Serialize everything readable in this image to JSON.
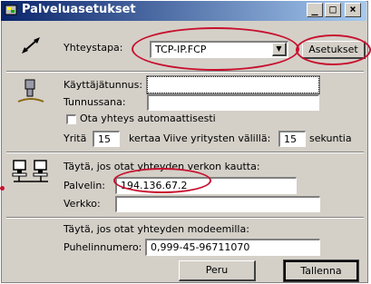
{
  "window": {
    "title": "Palveluasetukset"
  },
  "titlebar_buttons": {
    "minimize": "_",
    "maximize": "□",
    "close": "×"
  },
  "connection": {
    "method_label": "Yhteystapa:",
    "method_value": "TCP-IP.FCP",
    "settings_button": "Asetukset"
  },
  "login": {
    "username_label": "Käyttäjätunnus:",
    "username_value": "",
    "password_label": "Tunnussana:",
    "password_value": "",
    "auto_connect_label": "Ota yhteys automaattisesti",
    "auto_connect_checked": false,
    "retry_prefix": "Yritä",
    "retry_count": "15",
    "retry_mid": "kertaa",
    "delay_label": "Viive yritysten välillä:",
    "delay_value": "15",
    "delay_unit": "sekuntia"
  },
  "network": {
    "heading": "Täytä, jos otat yhteyden verkon kautta:",
    "server_label": "Palvelin:",
    "server_value": "194.136.67.2",
    "net_label": "Verkko:",
    "net_value": ""
  },
  "modem": {
    "heading": "Täytä, jos otat yhteyden modeemilla:",
    "phone_label": "Puhelinnumero:",
    "phone_value": "0,999-45-96711070"
  },
  "buttons": {
    "cancel": "Peru",
    "save": "Tallenna"
  },
  "colors": {
    "title_bar": "#0a246a",
    "annotation": "#c8102e",
    "face": "#d4d0c8"
  }
}
